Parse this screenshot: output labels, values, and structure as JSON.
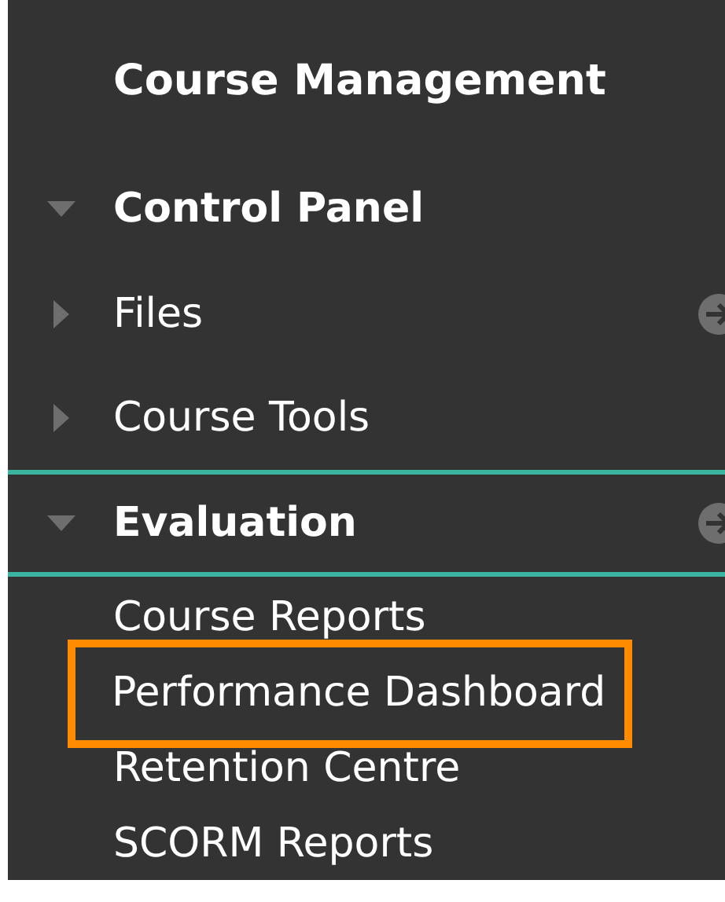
{
  "panel": {
    "title": "Course Management",
    "sections": [
      {
        "label": "Control Panel",
        "expanded": true,
        "current": false,
        "has_arrow": false,
        "children": [
          {
            "label": "Files",
            "expanded": false,
            "has_arrow": true,
            "highlighted": false
          },
          {
            "label": "Course Tools",
            "expanded": false,
            "has_arrow": false,
            "highlighted": false
          }
        ]
      },
      {
        "label": "Evaluation",
        "expanded": true,
        "current": true,
        "has_arrow": true,
        "children": [
          {
            "label": "Course Reports",
            "has_arrow": false,
            "highlighted": false
          },
          {
            "label": "Performance Dashboard",
            "has_arrow": false,
            "highlighted": true
          },
          {
            "label": "Retention Centre",
            "has_arrow": false,
            "highlighted": false
          },
          {
            "label": "SCORM Reports",
            "has_arrow": false,
            "highlighted": false
          }
        ]
      }
    ]
  }
}
